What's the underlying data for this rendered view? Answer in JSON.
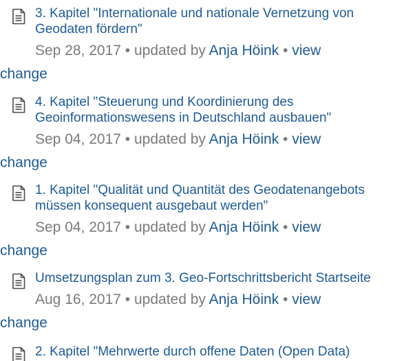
{
  "updates": [
    {
      "title_line1": "3. Kapitel \"Internationale und nationale Vernetzung von",
      "title_line2": "Geodaten fördern\"",
      "date": "Sep 28, 2017",
      "updated_by_label": "updated by",
      "author": "Anja Höink",
      "view_label": "view",
      "change_label": "change"
    },
    {
      "title_line1": "4. Kapitel \"Steuerung und Koordinierung des",
      "title_line2": "Geoinformationswesens in Deutschland ausbauen\"",
      "date": "Sep 04, 2017",
      "updated_by_label": "updated by",
      "author": "Anja Höink",
      "view_label": "view",
      "change_label": "change"
    },
    {
      "title_line1": "1. Kapitel \"Qualität und Quantität des Geodatenangebots",
      "title_line2": "müssen konsequent ausgebaut werden\"",
      "date": "Sep 04, 2017",
      "updated_by_label": "updated by",
      "author": "Anja Höink",
      "view_label": "view",
      "change_label": "change"
    },
    {
      "title_line1": "Umsetzungsplan zum 3. Geo-Fortschrittsbericht Startseite",
      "date": "Aug 16, 2017",
      "updated_by_label": "updated by",
      "author": "Anja Höink",
      "view_label": "view",
      "change_label": "change"
    },
    {
      "title_line1": "2. Kapitel \"Mehrwerte durch offene Daten (Open Data)"
    }
  ],
  "separator": "•",
  "icon": "page-document-icon",
  "colors": {
    "link": "#1e5a96",
    "meta_text": "#7a7a7a",
    "icon_stroke": "#4a4a4a"
  }
}
